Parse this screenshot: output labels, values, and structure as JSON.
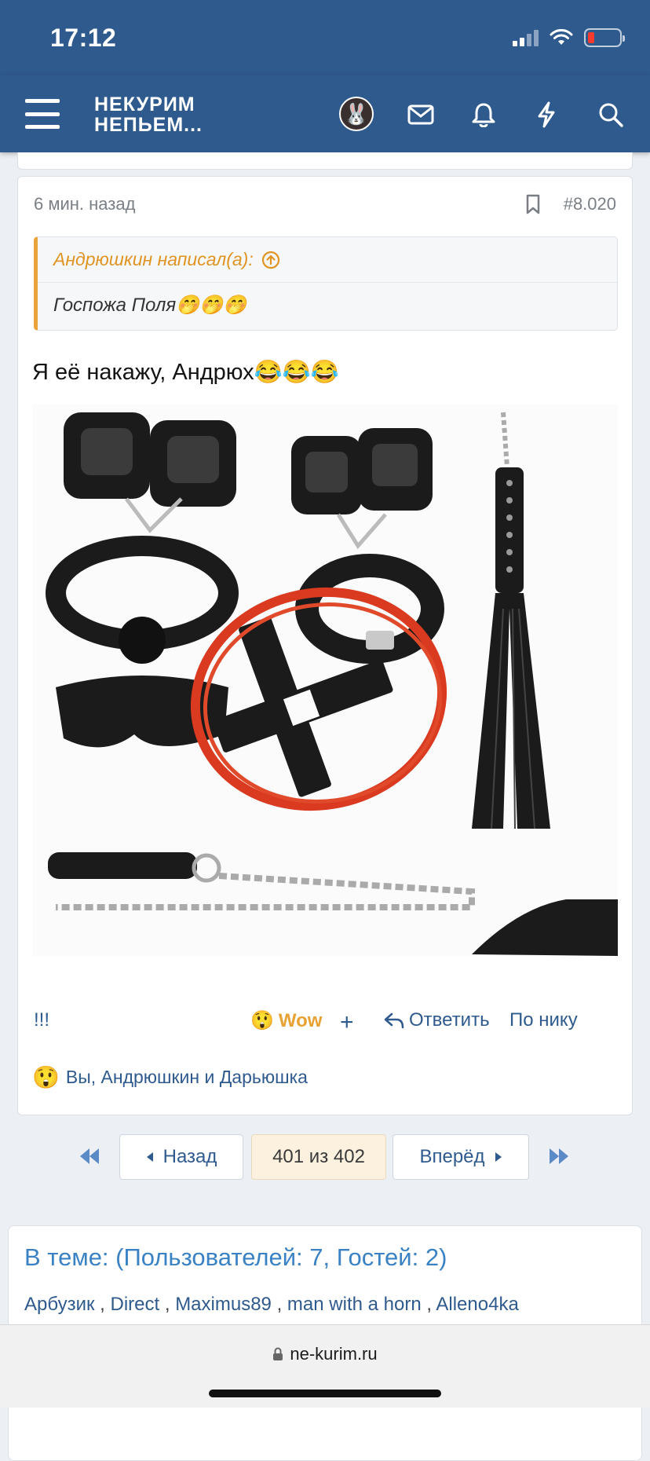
{
  "status": {
    "time": "17:12"
  },
  "header": {
    "logo_line1": "НЕКУРИМ",
    "logo_line2": "НЕПЬЕМ..."
  },
  "post": {
    "time_ago": "6 мин. назад",
    "number": "#8.020",
    "quote_author": "Андрюшкин написал(а):",
    "quote_text": "Госпожа Поля🤭🤭🤭",
    "text": "Я её накажу, Андрюх😂😂😂",
    "actions": {
      "exclaim": "!!!",
      "wow": "Wow",
      "plus": "+",
      "reply": "Ответить",
      "by_nick": "По нику"
    },
    "reactions_text": "Вы, Андрюшкин и Дарьюшка"
  },
  "pagination": {
    "back": "Назад",
    "current": "401 из 402",
    "next": "Вперёд"
  },
  "online": {
    "title": "В теме: (Пользователей: 7, Гостей: 2)",
    "users": [
      "Арбузик",
      "Direct",
      "Maximus89",
      "man with a horn",
      "Alleno4ka"
    ]
  },
  "browser": {
    "url": "ne-kurim.ru"
  },
  "colors": {
    "brand": "#2f5a8e",
    "accent": "#eaa33a",
    "link": "#3a82c4"
  }
}
